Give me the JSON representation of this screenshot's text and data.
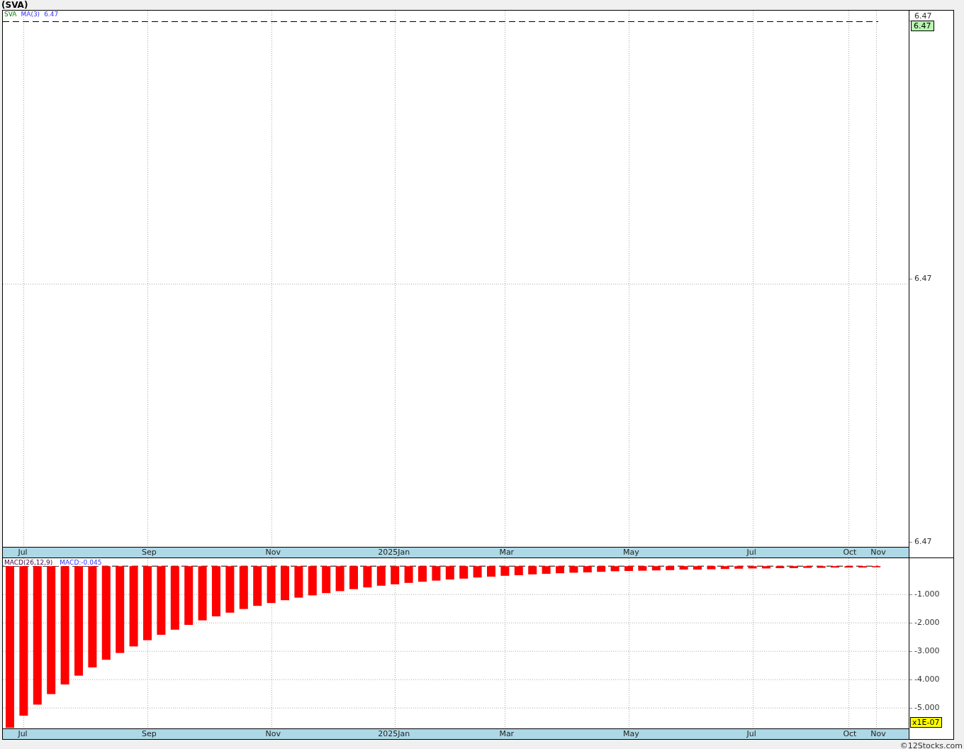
{
  "title": "(SVA)",
  "price_panel": {
    "legend": [
      "SVA",
      "MA(3)",
      "6.47"
    ],
    "y_labels": [
      "6.47",
      "6.47",
      "6.47"
    ],
    "last_value": "6.47",
    "x_labels": [
      "Jul",
      "Sep",
      "Nov",
      "2025Jan",
      "Mar",
      "May",
      "Jul",
      "Oct",
      "Nov"
    ]
  },
  "macd_panel": {
    "reading": "MACD:-0.045",
    "scale": "x1E-07",
    "chart_data": {
      "type": "bar",
      "title": "MACD(26,12,9)",
      "categories": [
        null,
        "Jul",
        null,
        null,
        null,
        null,
        null,
        null,
        null,
        null,
        "Sep",
        null,
        null,
        null,
        null,
        null,
        null,
        null,
        null,
        "Nov",
        null,
        null,
        null,
        null,
        null,
        null,
        null,
        null,
        "2025Jan",
        null,
        null,
        null,
        null,
        null,
        null,
        null,
        "Mar",
        null,
        null,
        null,
        null,
        null,
        null,
        null,
        null,
        "May",
        null,
        null,
        null,
        null,
        null,
        null,
        null,
        null,
        "Jul",
        null,
        null,
        null,
        null,
        null,
        null,
        "Oct",
        null,
        "Nov"
      ],
      "series": [
        {
          "color": "#ff0000",
          "values": [
            -5.7,
            -5.27,
            -4.88,
            -4.51,
            -4.17,
            -3.86,
            -3.57,
            -3.3,
            -3.06,
            -2.83,
            -2.61,
            -2.42,
            -2.24,
            -2.07,
            -1.91,
            -1.77,
            -1.64,
            -1.51,
            -1.4,
            -1.3,
            -1.2,
            -1.11,
            -1.03,
            -0.95,
            -0.88,
            -0.81,
            -0.75,
            -0.69,
            -0.64,
            -0.59,
            -0.55,
            -0.51,
            -0.47,
            -0.44,
            -0.4,
            -0.37,
            -0.34,
            -0.32,
            -0.29,
            -0.27,
            -0.25,
            -0.23,
            -0.22,
            -0.2,
            -0.18,
            -0.17,
            -0.16,
            -0.15,
            -0.14,
            -0.12,
            -0.12,
            -0.11,
            -0.1,
            -0.09,
            -0.08,
            -0.08,
            -0.07,
            -0.07,
            -0.06,
            -0.06,
            -0.05,
            -0.05,
            -0.05,
            -0.04
          ]
        }
      ],
      "ylim": [
        -5.72,
        0.28
      ],
      "yticks": [
        {
          "value": -1,
          "label": "-1.000"
        },
        {
          "value": -2,
          "label": "-2.000"
        },
        {
          "value": -3,
          "label": "-3.000"
        },
        {
          "value": -4,
          "label": "-4.000"
        },
        {
          "value": -5,
          "label": "-5.000"
        }
      ],
      "grid": true,
      "ref_lines": [
        {
          "axis": "y",
          "value": 0
        }
      ]
    }
  },
  "footer": "©12Stocks.com"
}
